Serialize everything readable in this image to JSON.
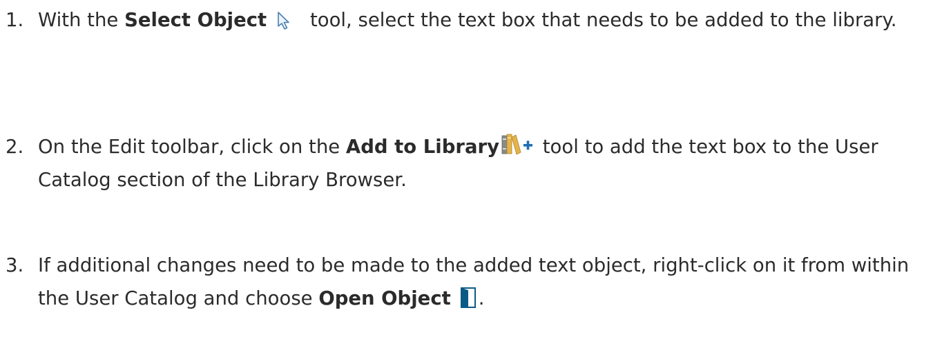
{
  "steps": [
    {
      "number": "1.",
      "text_before": "With the ",
      "bold": "Select Object",
      "icon": "select-object-arrow-icon",
      "text_after": " tool, select the text box that needs to be added to the library."
    },
    {
      "number": "2.",
      "text_before": "On the Edit toolbar, click on the ",
      "bold": "Add to Library",
      "icon": "add-to-library-books-plus-icon",
      "text_after": " tool to add the text box to the User Catalog section of the Library Browser."
    },
    {
      "number": "3.",
      "text_before": "If additional changes need to be made to the added text object, right-click on it from within the User Catalog and choose ",
      "bold": "Open Object",
      "icon": "open-object-door-icon",
      "text_after": "."
    }
  ],
  "colors": {
    "text": "#2b2b2b",
    "select_arrow_outline": "#4a7fb0",
    "select_arrow_fill": "#eaf3fb",
    "library_book_gray": "#8a8a8a",
    "library_book_yellow": "#e4b44a",
    "library_plus": "#1f6fb3",
    "open_object_blue": "#0b5a85"
  }
}
